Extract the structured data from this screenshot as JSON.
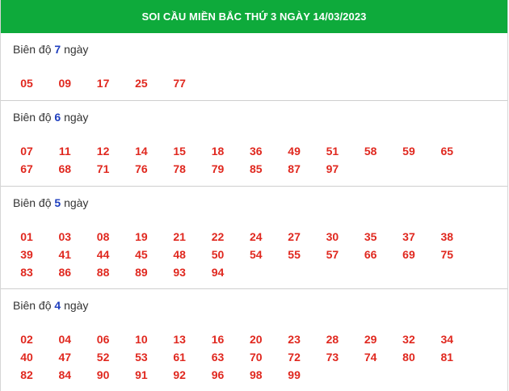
{
  "header": {
    "title": "SOI CẦU MIỀN BẮC THỨ 3 NGÀY 14/03/2023"
  },
  "colors": {
    "header_bg": "#0eaa3b",
    "number": "#e0281f",
    "label_number": "#1f3fbf"
  },
  "sections": [
    {
      "prefix": "Biên độ",
      "amplitude": "7",
      "suffix": "ngày",
      "numbers": [
        "05",
        "09",
        "17",
        "25",
        "77"
      ]
    },
    {
      "prefix": "Biên độ",
      "amplitude": "6",
      "suffix": "ngày",
      "numbers": [
        "07",
        "11",
        "12",
        "14",
        "15",
        "18",
        "36",
        "49",
        "51",
        "58",
        "59",
        "65",
        "67",
        "68",
        "71",
        "76",
        "78",
        "79",
        "85",
        "87",
        "97"
      ]
    },
    {
      "prefix": "Biên độ",
      "amplitude": "5",
      "suffix": "ngày",
      "numbers": [
        "01",
        "03",
        "08",
        "19",
        "21",
        "22",
        "24",
        "27",
        "30",
        "35",
        "37",
        "38",
        "39",
        "41",
        "44",
        "45",
        "48",
        "50",
        "54",
        "55",
        "57",
        "66",
        "69",
        "75",
        "83",
        "86",
        "88",
        "89",
        "93",
        "94"
      ]
    },
    {
      "prefix": "Biên độ",
      "amplitude": "4",
      "suffix": "ngày",
      "numbers": [
        "02",
        "04",
        "06",
        "10",
        "13",
        "16",
        "20",
        "23",
        "28",
        "29",
        "32",
        "34",
        "40",
        "47",
        "52",
        "53",
        "61",
        "63",
        "70",
        "72",
        "73",
        "74",
        "80",
        "81",
        "82",
        "84",
        "90",
        "91",
        "92",
        "96",
        "98",
        "99"
      ]
    }
  ]
}
